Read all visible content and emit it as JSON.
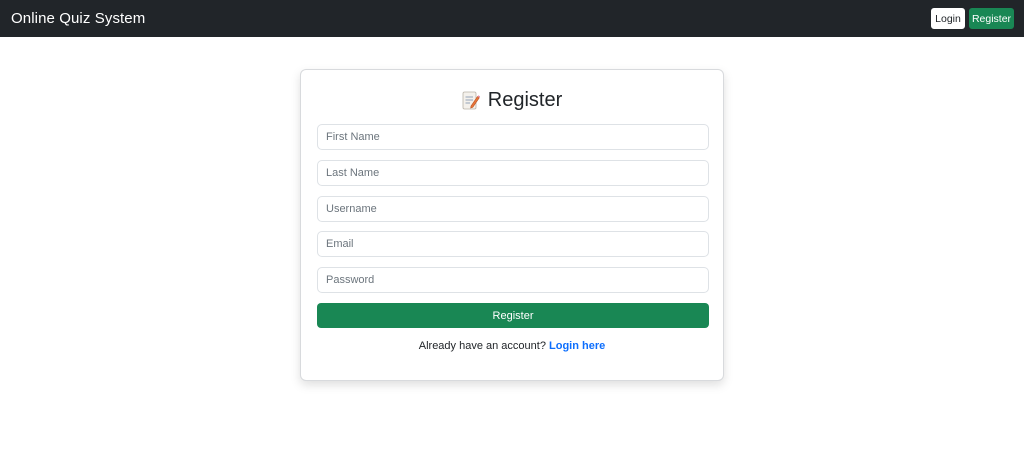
{
  "navbar": {
    "brand": "Online Quiz System",
    "login_label": "Login",
    "register_label": "Register"
  },
  "form": {
    "title": "Register",
    "icon": "memo-icon",
    "fields": {
      "first_name": {
        "placeholder": "First Name",
        "value": ""
      },
      "last_name": {
        "placeholder": "Last Name",
        "value": ""
      },
      "username": {
        "placeholder": "Username",
        "value": ""
      },
      "email": {
        "placeholder": "Email",
        "value": ""
      },
      "password": {
        "placeholder": "Password",
        "value": ""
      }
    },
    "submit_label": "Register",
    "footer_prefix": "Already have an account?",
    "footer_link": "Login here"
  },
  "colors": {
    "navbar_bg": "#212529",
    "success": "#198754",
    "link": "#0d6efd"
  }
}
